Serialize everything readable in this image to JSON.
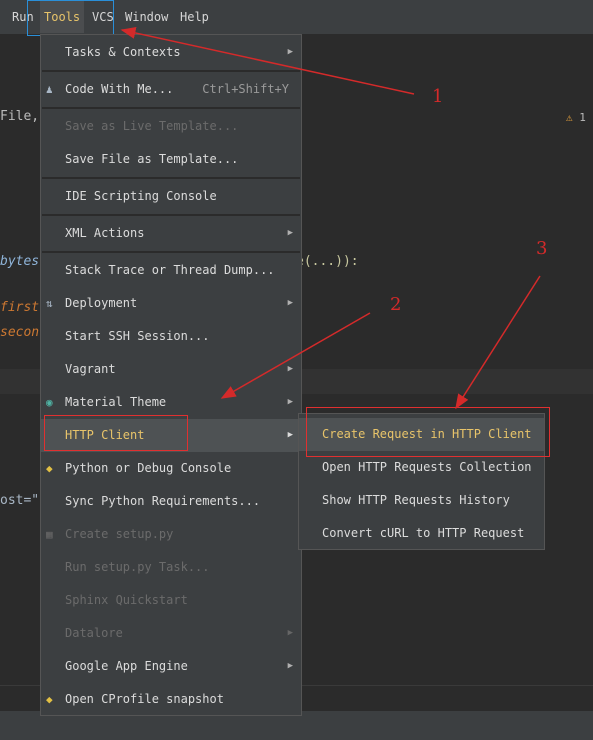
{
  "menubar": {
    "items": [
      "Run",
      "Tools",
      "VCS",
      "Window",
      "Help"
    ],
    "mnemonic_first": [
      "R",
      "T",
      "V",
      "W",
      "H"
    ]
  },
  "editor": {
    "fragments": [
      "File,",
      "bytes",
      "e(...)):",
      "first",
      "secon",
      "ost=\""
    ],
    "warning_count": "1"
  },
  "tools_menu": {
    "items": [
      {
        "label": "Tasks & Contexts",
        "submenu": true,
        "disabled": false
      },
      {
        "label": "Code With Me...",
        "shortcut": "Ctrl+Shift+Y",
        "icon": "people-icon",
        "disabled": false
      },
      {
        "label": "Save as Live Template...",
        "disabled": true
      },
      {
        "label": "Save File as Template...",
        "disabled": false
      },
      {
        "label": "IDE Scripting Console",
        "disabled": false
      },
      {
        "label": "XML Actions",
        "submenu": true,
        "disabled": false
      },
      {
        "label": "Stack Trace or Thread Dump...",
        "disabled": false
      },
      {
        "label": "Deployment",
        "submenu": true,
        "icon": "sync-arrows-icon",
        "disabled": false
      },
      {
        "label": "Start SSH Session...",
        "disabled": false
      },
      {
        "label": "Vagrant",
        "submenu": true,
        "disabled": false
      },
      {
        "label": "Material Theme",
        "submenu": true,
        "icon": "material-theme-icon",
        "disabled": false
      },
      {
        "label": "HTTP Client",
        "submenu": true,
        "selected": true,
        "disabled": false
      },
      {
        "label": "Python or Debug Console",
        "icon": "python-icon",
        "disabled": false
      },
      {
        "label": "Sync Python Requirements...",
        "disabled": false
      },
      {
        "label": "Create setup.py",
        "icon": "python-package-icon",
        "disabled": true
      },
      {
        "label": "Run setup.py Task...",
        "disabled": true
      },
      {
        "label": "Sphinx Quickstart",
        "disabled": true
      },
      {
        "label": "Datalore",
        "submenu": true,
        "disabled": true
      },
      {
        "label": "Google App Engine",
        "submenu": true,
        "disabled": false
      },
      {
        "label": "Open CProfile snapshot",
        "icon": "python-icon",
        "disabled": false
      }
    ]
  },
  "http_submenu": {
    "items": [
      "Create Request in HTTP Client",
      "Open HTTP Requests Collection",
      "Show HTTP Requests History",
      "Convert cURL to HTTP Request"
    ]
  },
  "annotations": [
    "1",
    "2",
    "3"
  ],
  "colors": {
    "highlight_text": "#e8c46a",
    "annotation_red": "#d42a2a",
    "menu_bg": "#3c3f41",
    "editor_bg": "#2b2b2b"
  }
}
